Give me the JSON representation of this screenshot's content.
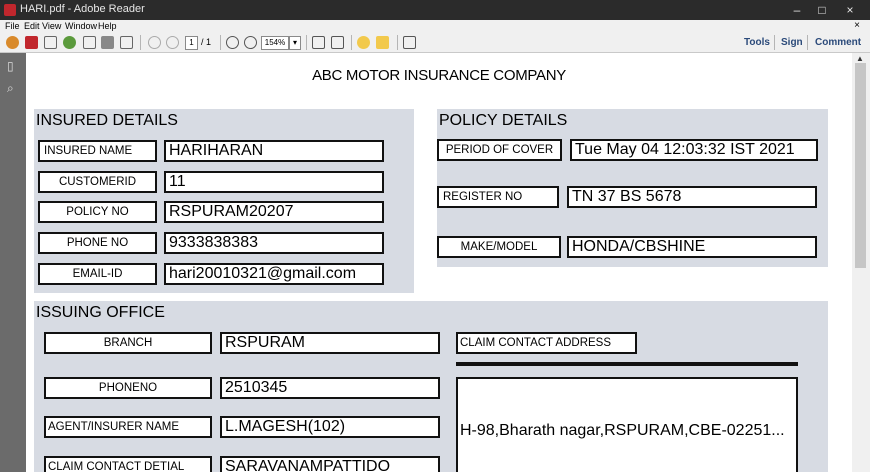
{
  "window": {
    "title": "HARI.pdf - Adobe Reader",
    "controls": {
      "minimize": "–",
      "maximize": "□",
      "close": "×"
    }
  },
  "menu": {
    "items": [
      "File",
      "Edit",
      "View",
      "Window",
      "Help"
    ],
    "close": "×"
  },
  "toolbar": {
    "page_current": "1",
    "page_total": "/ 1",
    "zoom": "154%",
    "zoom_dropdown": "▾",
    "links": [
      "Tools",
      "Sign",
      "Comment"
    ]
  },
  "document": {
    "title": "ABC MOTOR INSURANCE COMPANY",
    "insured_details": {
      "heading": "INSURED DETAILS",
      "rows": [
        {
          "label": "INSURED NAME",
          "value": "HARIHARAN"
        },
        {
          "label": "CUSTOMERID",
          "value": "11"
        },
        {
          "label": "POLICY NO",
          "value": "RSPURAM20207"
        },
        {
          "label": "PHONE NO",
          "value": "9333838383"
        },
        {
          "label": "EMAIL-ID",
          "value": "hari20010321@gmail.com"
        }
      ]
    },
    "policy_details": {
      "heading": "POLICY DETAILS",
      "rows": [
        {
          "label": "PERIOD OF COVER",
          "value": "Tue May 04 12:03:32 IST 2021"
        },
        {
          "label": "REGISTER NO",
          "value": "TN 37 BS 5678"
        },
        {
          "label": "MAKE/MODEL",
          "value": "HONDA/CBSHINE"
        }
      ]
    },
    "issuing_office": {
      "heading": "ISSUING OFFICE",
      "rows": [
        {
          "label": "BRANCH",
          "value": "RSPURAM"
        },
        {
          "label": "PHONENO",
          "value": "2510345"
        },
        {
          "label": "AGENT/INSURER NAME",
          "value": "L.MAGESH(102)"
        },
        {
          "label": "CLAIM CONTACT DETIAL",
          "value": "SARAVANAMPATTIDO"
        }
      ],
      "claim_contact_address_label": "CLAIM CONTACT ADDRESS",
      "claim_contact_address_value": "H-98,Bharath nagar,RSPURAM,CBE-02251..."
    }
  }
}
